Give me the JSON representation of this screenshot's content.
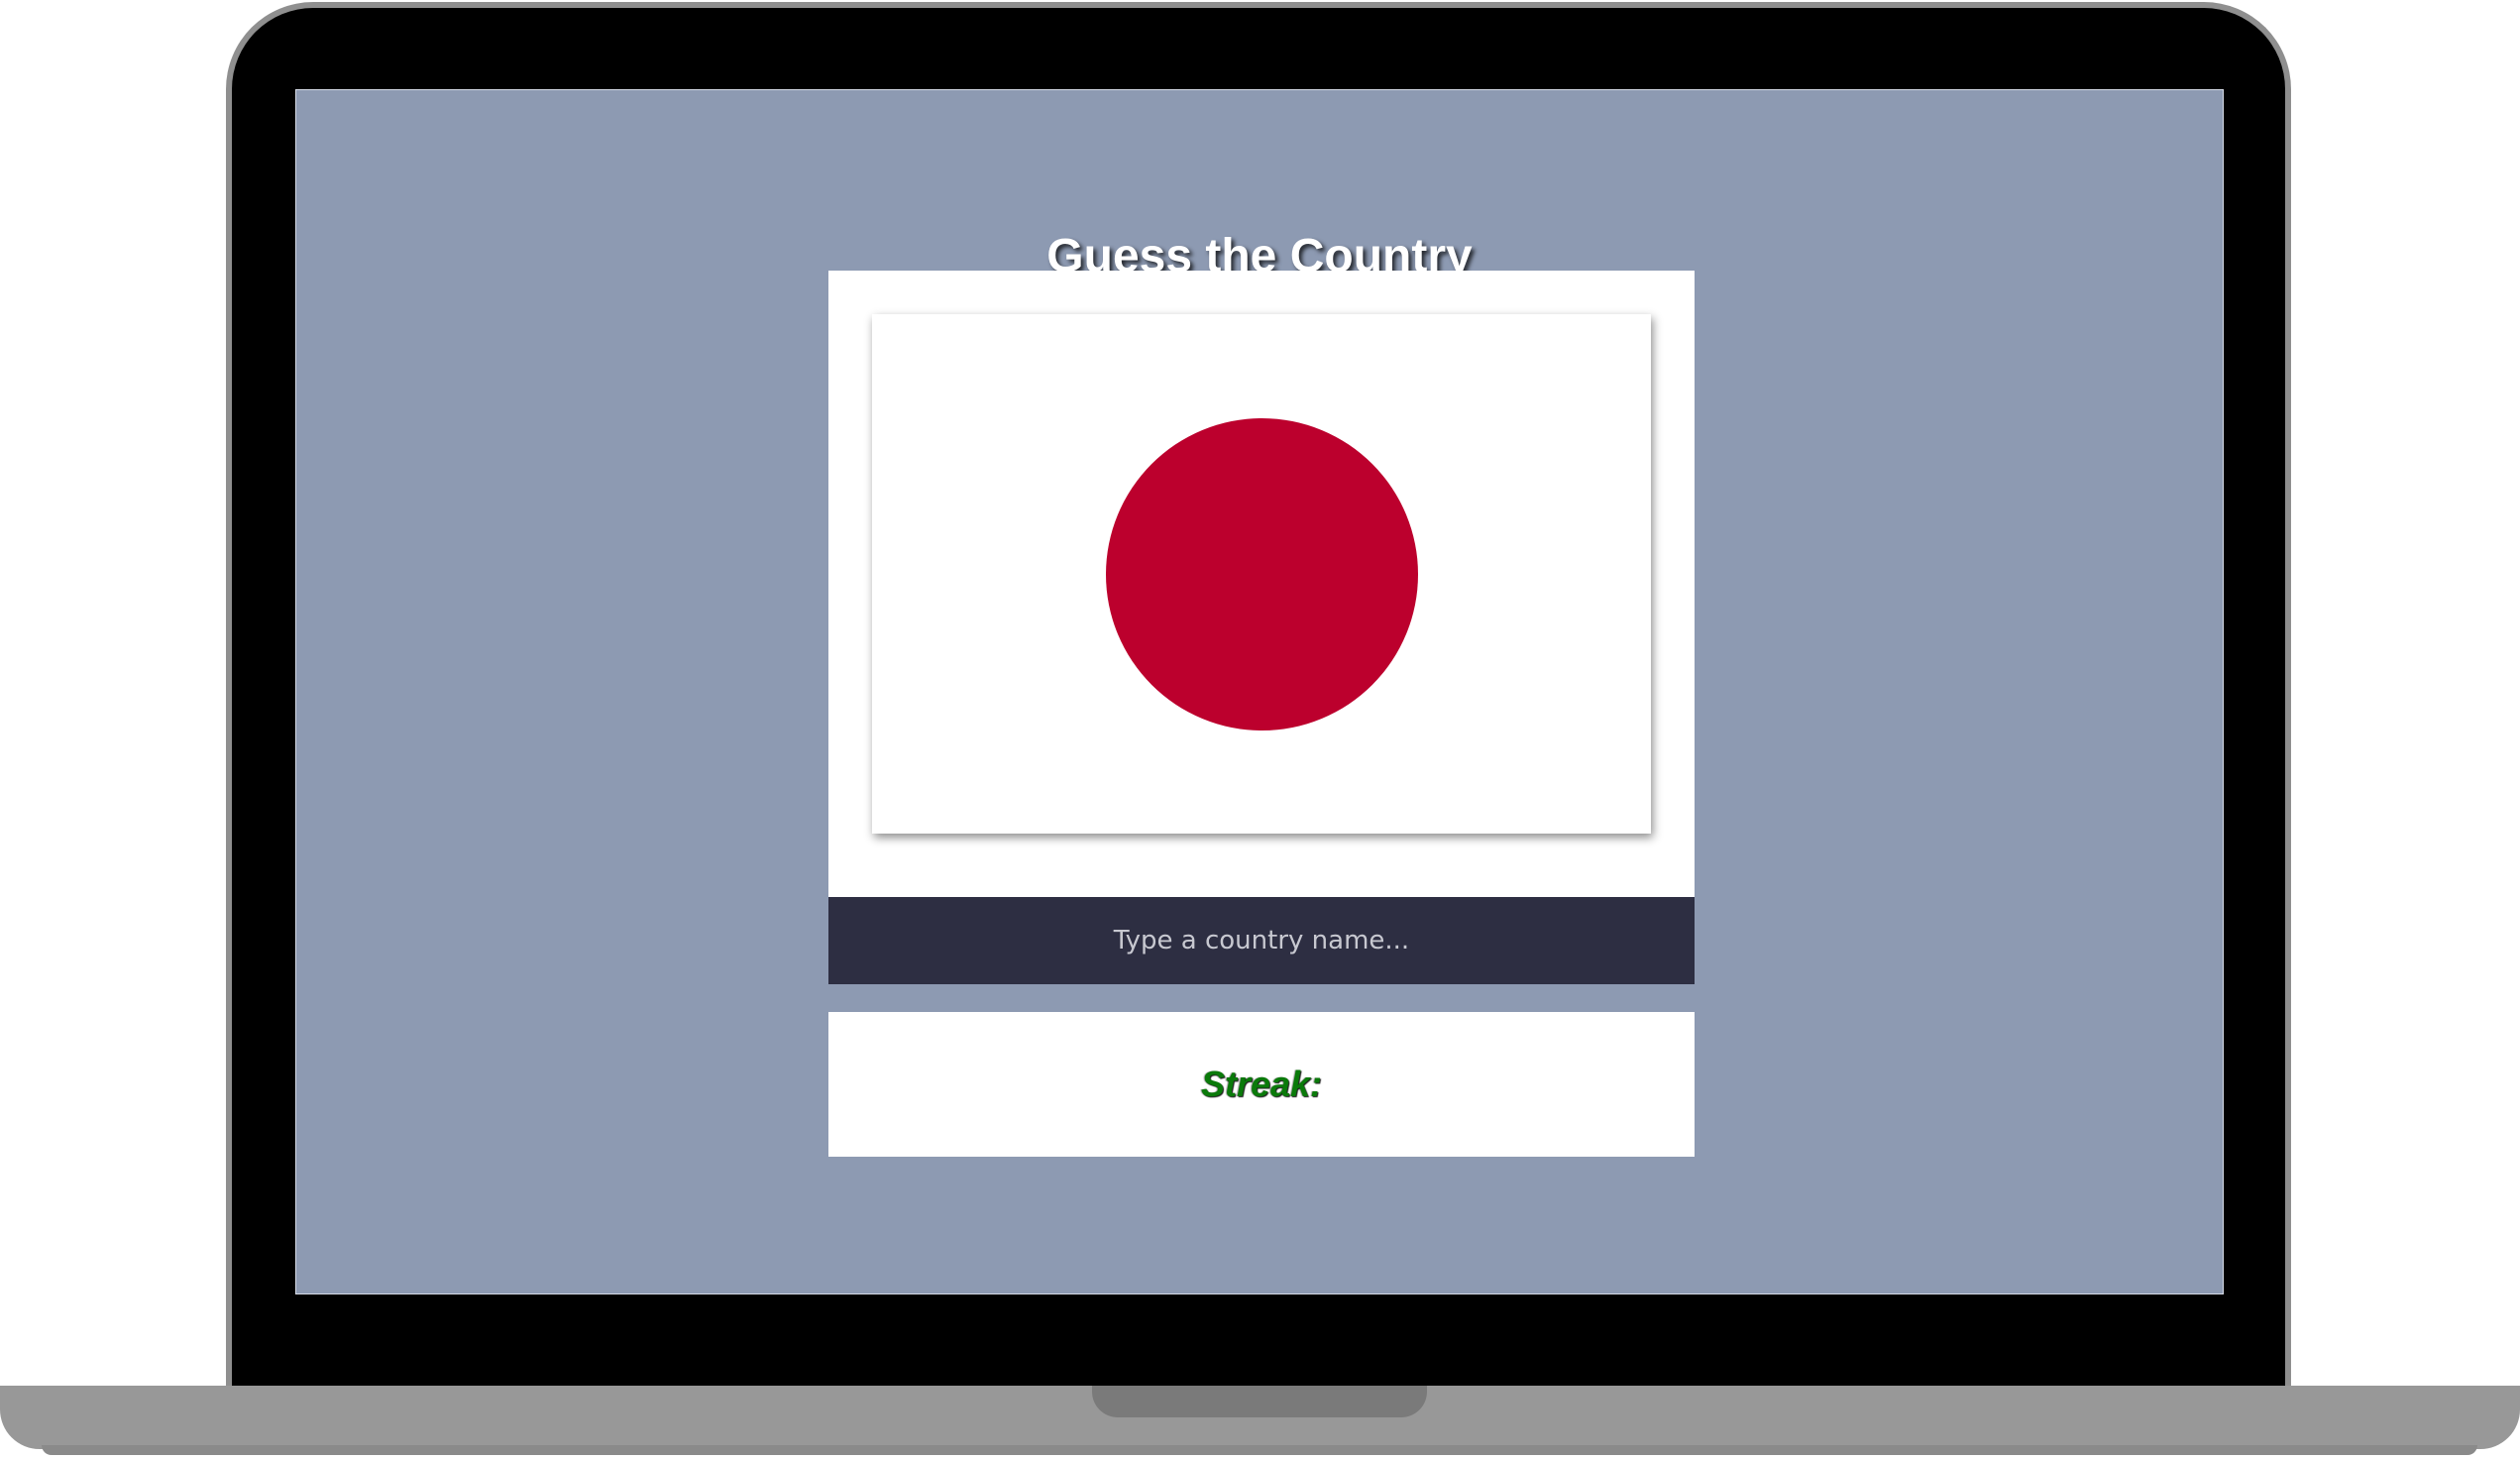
{
  "app": {
    "title": "Guess the Country"
  },
  "flag": {
    "country_hint": "japan-flag",
    "background_color": "#ffffff",
    "disc_color": "#bc002d"
  },
  "guess": {
    "placeholder": "Type a country name...",
    "value": ""
  },
  "streak": {
    "label": "Streak:"
  },
  "colors": {
    "screen_background": "#8d9ab2",
    "input_background": "#2d2e42",
    "streak_text": "#0a7a0a"
  }
}
